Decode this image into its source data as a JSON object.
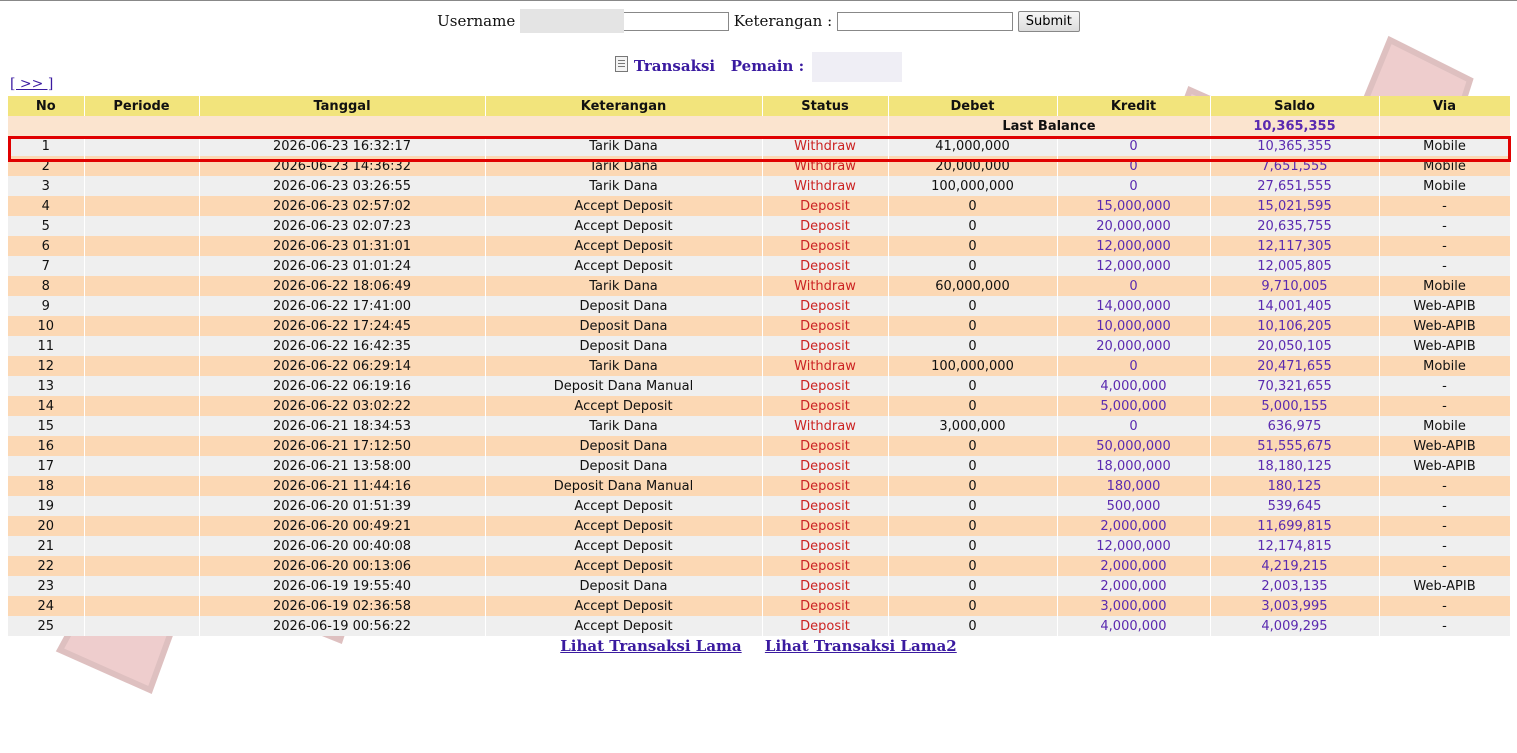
{
  "form": {
    "username_label": "Username",
    "username_value": "",
    "keterangan_label": "Keterangan :",
    "keterangan_value": "",
    "submit_label": "Submit"
  },
  "title": {
    "transaksi": "Transaksi",
    "pemain": "Pemain :",
    "pemain_value": ""
  },
  "nav": {
    "next_label": "[ >> ]"
  },
  "table": {
    "headers": [
      "No",
      "Periode",
      "Tanggal",
      "Keterangan",
      "Status",
      "Debet",
      "Kredit",
      "Saldo",
      "Via"
    ],
    "last_balance_label": "Last Balance",
    "last_balance_value": "10,365,355",
    "rows": [
      {
        "no": "1",
        "periode": "",
        "tanggal": "2026-06-23 16:32:17",
        "keterangan": "Tarik Dana",
        "status": "Withdraw",
        "debet": "41,000,000",
        "kredit": "0",
        "saldo": "10,365,355",
        "via": "Mobile"
      },
      {
        "no": "2",
        "periode": "",
        "tanggal": "2026-06-23 14:36:32",
        "keterangan": "Tarik Dana",
        "status": "Withdraw",
        "debet": "20,000,000",
        "kredit": "0",
        "saldo": "7,651,555",
        "via": "Mobile"
      },
      {
        "no": "3",
        "periode": "",
        "tanggal": "2026-06-23 03:26:55",
        "keterangan": "Tarik Dana",
        "status": "Withdraw",
        "debet": "100,000,000",
        "kredit": "0",
        "saldo": "27,651,555",
        "via": "Mobile"
      },
      {
        "no": "4",
        "periode": "",
        "tanggal": "2026-06-23 02:57:02",
        "keterangan": "Accept Deposit",
        "status": "Deposit",
        "debet": "0",
        "kredit": "15,000,000",
        "saldo": "15,021,595",
        "via": "-"
      },
      {
        "no": "5",
        "periode": "",
        "tanggal": "2026-06-23 02:07:23",
        "keterangan": "Accept Deposit",
        "status": "Deposit",
        "debet": "0",
        "kredit": "20,000,000",
        "saldo": "20,635,755",
        "via": "-"
      },
      {
        "no": "6",
        "periode": "",
        "tanggal": "2026-06-23 01:31:01",
        "keterangan": "Accept Deposit",
        "status": "Deposit",
        "debet": "0",
        "kredit": "12,000,000",
        "saldo": "12,117,305",
        "via": "-"
      },
      {
        "no": "7",
        "periode": "",
        "tanggal": "2026-06-23 01:01:24",
        "keterangan": "Accept Deposit",
        "status": "Deposit",
        "debet": "0",
        "kredit": "12,000,000",
        "saldo": "12,005,805",
        "via": "-"
      },
      {
        "no": "8",
        "periode": "",
        "tanggal": "2026-06-22 18:06:49",
        "keterangan": "Tarik Dana",
        "status": "Withdraw",
        "debet": "60,000,000",
        "kredit": "0",
        "saldo": "9,710,005",
        "via": "Mobile"
      },
      {
        "no": "9",
        "periode": "",
        "tanggal": "2026-06-22 17:41:00",
        "keterangan": "Deposit Dana",
        "status": "Deposit",
        "debet": "0",
        "kredit": "14,000,000",
        "saldo": "14,001,405",
        "via": "Web-APIB"
      },
      {
        "no": "10",
        "periode": "",
        "tanggal": "2026-06-22 17:24:45",
        "keterangan": "Deposit Dana",
        "status": "Deposit",
        "debet": "0",
        "kredit": "10,000,000",
        "saldo": "10,106,205",
        "via": "Web-APIB"
      },
      {
        "no": "11",
        "periode": "",
        "tanggal": "2026-06-22 16:42:35",
        "keterangan": "Deposit Dana",
        "status": "Deposit",
        "debet": "0",
        "kredit": "20,000,000",
        "saldo": "20,050,105",
        "via": "Web-APIB"
      },
      {
        "no": "12",
        "periode": "",
        "tanggal": "2026-06-22 06:29:14",
        "keterangan": "Tarik Dana",
        "status": "Withdraw",
        "debet": "100,000,000",
        "kredit": "0",
        "saldo": "20,471,655",
        "via": "Mobile"
      },
      {
        "no": "13",
        "periode": "",
        "tanggal": "2026-06-22 06:19:16",
        "keterangan": "Deposit Dana Manual",
        "status": "Deposit",
        "debet": "0",
        "kredit": "4,000,000",
        "saldo": "70,321,655",
        "via": "-"
      },
      {
        "no": "14",
        "periode": "",
        "tanggal": "2026-06-22 03:02:22",
        "keterangan": "Accept Deposit",
        "status": "Deposit",
        "debet": "0",
        "kredit": "5,000,000",
        "saldo": "5,000,155",
        "via": "-"
      },
      {
        "no": "15",
        "periode": "",
        "tanggal": "2026-06-21 18:34:53",
        "keterangan": "Tarik Dana",
        "status": "Withdraw",
        "debet": "3,000,000",
        "kredit": "0",
        "saldo": "636,975",
        "via": "Mobile"
      },
      {
        "no": "16",
        "periode": "",
        "tanggal": "2026-06-21 17:12:50",
        "keterangan": "Deposit Dana",
        "status": "Deposit",
        "debet": "0",
        "kredit": "50,000,000",
        "saldo": "51,555,675",
        "via": "Web-APIB"
      },
      {
        "no": "17",
        "periode": "",
        "tanggal": "2026-06-21 13:58:00",
        "keterangan": "Deposit Dana",
        "status": "Deposit",
        "debet": "0",
        "kredit": "18,000,000",
        "saldo": "18,180,125",
        "via": "Web-APIB"
      },
      {
        "no": "18",
        "periode": "",
        "tanggal": "2026-06-21 11:44:16",
        "keterangan": "Deposit Dana Manual",
        "status": "Deposit",
        "debet": "0",
        "kredit": "180,000",
        "saldo": "180,125",
        "via": "-"
      },
      {
        "no": "19",
        "periode": "",
        "tanggal": "2026-06-20 01:51:39",
        "keterangan": "Accept Deposit",
        "status": "Deposit",
        "debet": "0",
        "kredit": "500,000",
        "saldo": "539,645",
        "via": "-"
      },
      {
        "no": "20",
        "periode": "",
        "tanggal": "2026-06-20 00:49:21",
        "keterangan": "Accept Deposit",
        "status": "Deposit",
        "debet": "0",
        "kredit": "2,000,000",
        "saldo": "11,699,815",
        "via": "-"
      },
      {
        "no": "21",
        "periode": "",
        "tanggal": "2026-06-20 00:40:08",
        "keterangan": "Accept Deposit",
        "status": "Deposit",
        "debet": "0",
        "kredit": "12,000,000",
        "saldo": "12,174,815",
        "via": "-"
      },
      {
        "no": "22",
        "periode": "",
        "tanggal": "2026-06-20 00:13:06",
        "keterangan": "Accept Deposit",
        "status": "Deposit",
        "debet": "0",
        "kredit": "2,000,000",
        "saldo": "4,219,215",
        "via": "-"
      },
      {
        "no": "23",
        "periode": "",
        "tanggal": "2026-06-19 19:55:40",
        "keterangan": "Deposit Dana",
        "status": "Deposit",
        "debet": "0",
        "kredit": "2,000,000",
        "saldo": "2,003,135",
        "via": "Web-APIB"
      },
      {
        "no": "24",
        "periode": "",
        "tanggal": "2026-06-19 02:36:58",
        "keterangan": "Accept Deposit",
        "status": "Deposit",
        "debet": "0",
        "kredit": "3,000,000",
        "saldo": "3,003,995",
        "via": "-"
      },
      {
        "no": "25",
        "periode": "",
        "tanggal": "2026-06-19 00:56:22",
        "keterangan": "Accept Deposit",
        "status": "Deposit",
        "debet": "0",
        "kredit": "4,000,000",
        "saldo": "4,009,295",
        "via": "-"
      }
    ]
  },
  "bottom_links": [
    "Lihat Transaksi Lama",
    "Lihat Transaksi Lama2"
  ],
  "colors": {
    "header_bg": "#f2e47c",
    "row_alt_a": "#efefef",
    "row_alt_b": "#fcd8b4",
    "status_red": "#cc2222",
    "link_purple": "#3a1aa0",
    "value_purple": "#5a2ab0",
    "highlight_red": "#e00000"
  }
}
